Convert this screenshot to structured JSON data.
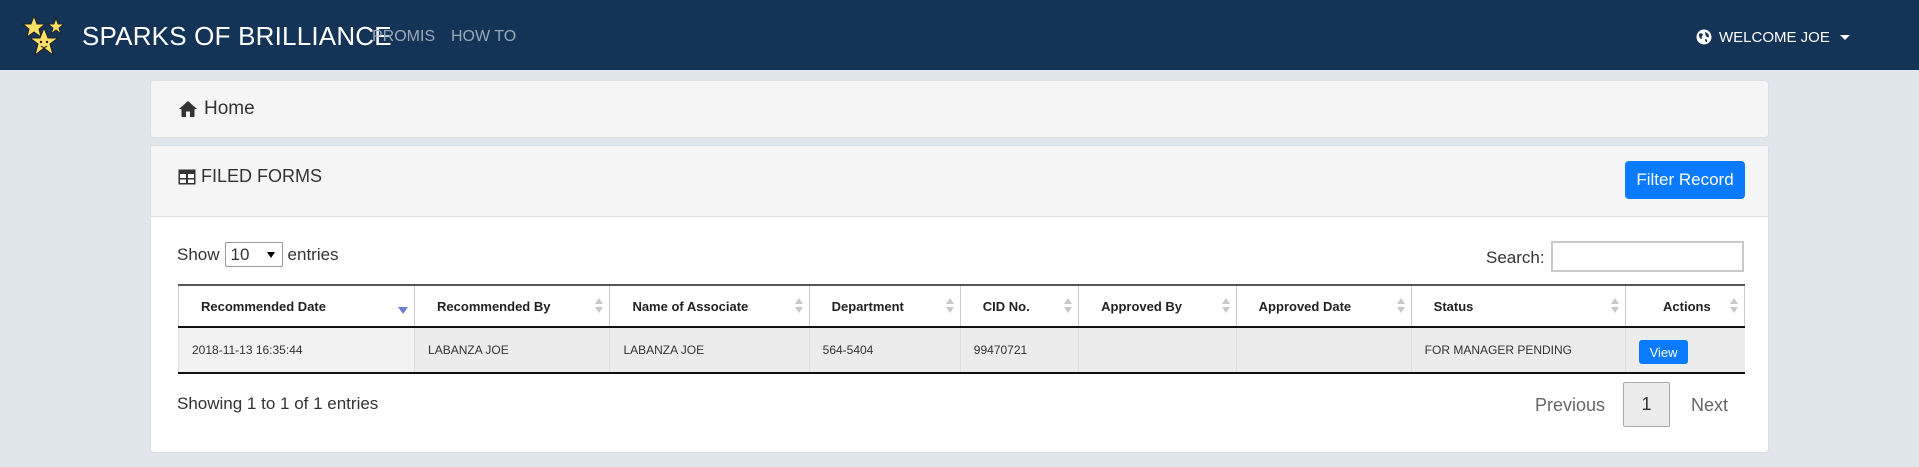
{
  "navbar": {
    "brand": "SPARKS OF BRILLIANCE",
    "links": [
      "PROMIS",
      "HOW TO"
    ],
    "user_label": "WELCOME JOE",
    "bg_color": "#133456"
  },
  "breadcrumb": {
    "home": "Home"
  },
  "forms": {
    "title": "FILED FORMS",
    "filter_button": "Filter Record",
    "show_prefix": "Show",
    "page_size": "10",
    "show_suffix": "entries",
    "search_label": "Search:",
    "columns": [
      "Recommended Date",
      "Recommended By",
      "Name of Associate",
      "Department",
      "CID No.",
      "Approved By",
      "Approved Date",
      "Status",
      "Actions"
    ],
    "rows": [
      {
        "recommended_date": "2018-11-13 16:35:44",
        "recommended_by": "LABANZA JOE",
        "associate": "LABANZA JOE",
        "department": "564-5404",
        "cid": "99470721",
        "approved_by": "",
        "approved_date": "",
        "status": "FOR MANAGER PENDING",
        "action": "View"
      }
    ],
    "info": "Showing 1 to 1 of 1 entries",
    "pagination": {
      "previous": "Previous",
      "current": "1",
      "next": "Next"
    }
  },
  "accent_color": "#0a7bff"
}
